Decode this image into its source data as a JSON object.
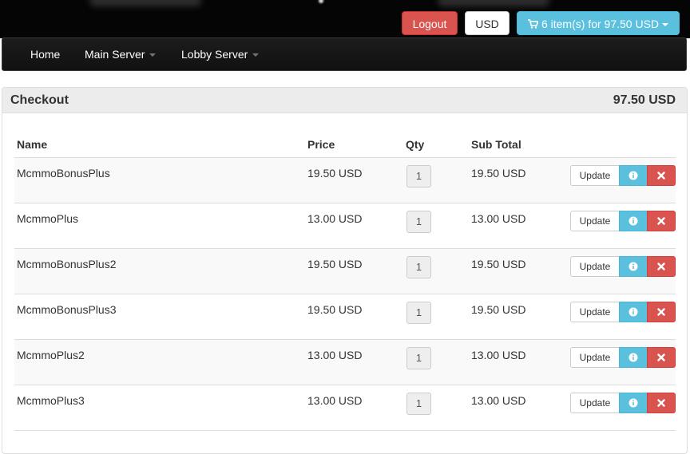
{
  "header": {
    "logout_label": "Logout",
    "currency_label": "USD",
    "cart_label": "6 item(s) for 97.50 USD"
  },
  "nav": {
    "home": "Home",
    "main_server": "Main Server",
    "lobby_server": "Lobby Server"
  },
  "checkout": {
    "title": "Checkout",
    "total": "97.50 USD",
    "columns": {
      "name": "Name",
      "price": "Price",
      "qty": "Qty",
      "subtotal": "Sub Total"
    },
    "update_label": "Update",
    "items": [
      {
        "name": "McmmoBonusPlus",
        "price": "19.50 USD",
        "qty": "1",
        "subtotal": "19.50 USD"
      },
      {
        "name": "McmmoPlus",
        "price": "13.00 USD",
        "qty": "1",
        "subtotal": "13.00 USD"
      },
      {
        "name": "McmmoBonusPlus2",
        "price": "19.50 USD",
        "qty": "1",
        "subtotal": "19.50 USD"
      },
      {
        "name": "McmmoBonusPlus3",
        "price": "19.50 USD",
        "qty": "1",
        "subtotal": "19.50 USD"
      },
      {
        "name": "McmmoPlus2",
        "price": "13.00 USD",
        "qty": "1",
        "subtotal": "13.00 USD"
      },
      {
        "name": "McmmoPlus3",
        "price": "13.00 USD",
        "qty": "1",
        "subtotal": "13.00 USD"
      }
    ]
  },
  "colors": {
    "danger": "#d9534f",
    "info": "#5bc0de",
    "navbar": "#111111"
  },
  "icons": {
    "cart": "shopping-cart-icon",
    "info": "info-icon",
    "remove": "close-icon"
  }
}
